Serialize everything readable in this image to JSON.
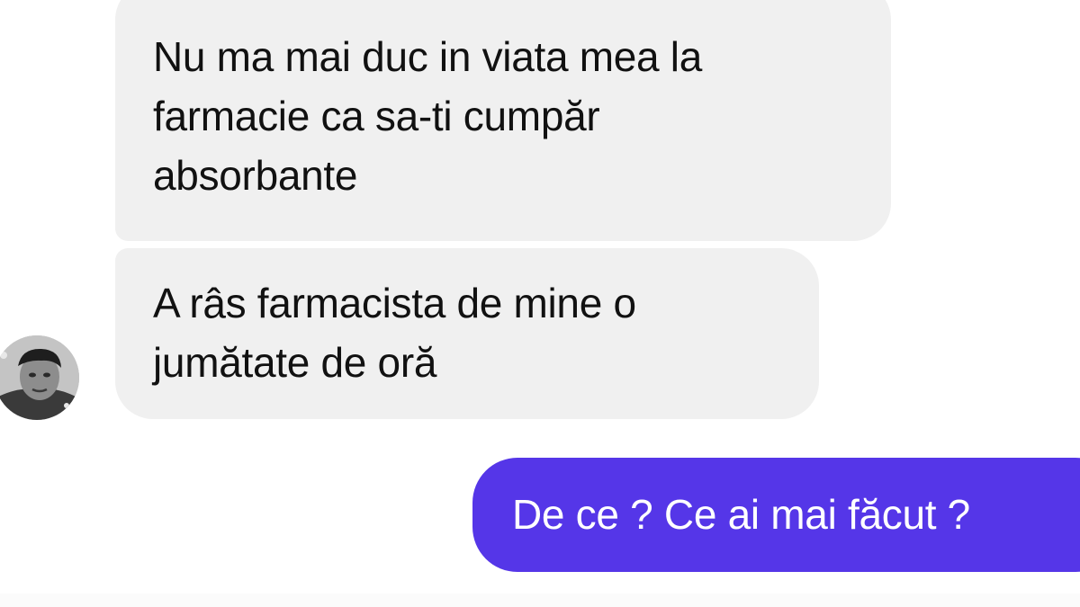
{
  "conversation": {
    "messages": [
      {
        "sender": "contact",
        "lines": [
          "Nu ma mai duc in viata mea la",
          "farmacie ca sa-ti cumpăr",
          "absorbante"
        ]
      },
      {
        "sender": "contact",
        "lines": [
          "A râs farmacista de mine o",
          "jumătate de oră"
        ]
      },
      {
        "sender": "me",
        "text": "De ce  ? Ce ai mai făcut ?"
      }
    ]
  },
  "colors": {
    "incoming_bubble": "#f0f0f0",
    "outgoing_bubble": "#5536e8",
    "incoming_text": "#111111",
    "outgoing_text": "#ffffff"
  },
  "icons": {
    "contact_avatar": "person-photo-avatar"
  }
}
